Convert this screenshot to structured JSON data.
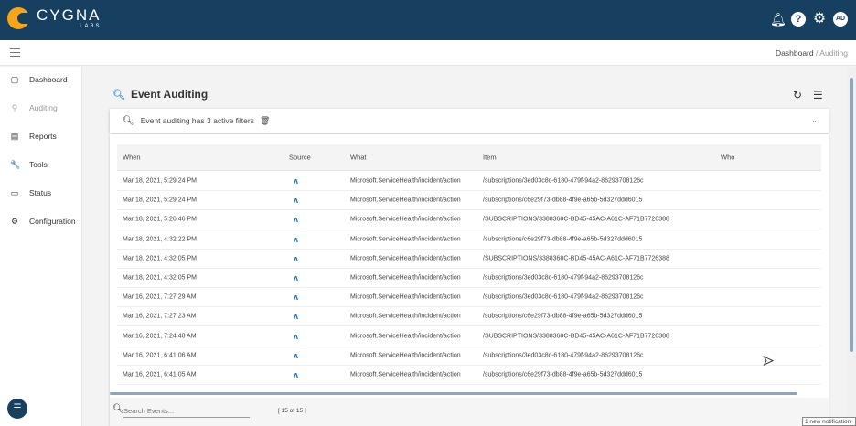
{
  "header": {
    "brand": "CYGNA",
    "brand_sub": "LABS",
    "avatar": "AD",
    "icons": [
      "bell-icon",
      "help-icon",
      "gear-icon"
    ]
  },
  "breadcrumb": {
    "parent": "Dashboard",
    "separator": "/",
    "current": "Auditing"
  },
  "sidebar": {
    "items": [
      {
        "label": "Dashboard",
        "icon": "monitor-icon",
        "glyph": "▢"
      },
      {
        "label": "Auditing",
        "icon": "search-icon",
        "glyph": "⚲",
        "active": true
      },
      {
        "label": "Reports",
        "icon": "reports-icon",
        "glyph": "▤"
      },
      {
        "label": "Tools",
        "icon": "wrench-icon",
        "glyph": "🔧"
      },
      {
        "label": "Status",
        "icon": "status-icon",
        "glyph": "▭"
      },
      {
        "label": "Configuration",
        "icon": "config-icon",
        "glyph": "⚙"
      }
    ]
  },
  "page": {
    "title": "Event Auditing",
    "filter_text": "Event auditing has 3 active filters"
  },
  "table": {
    "columns": [
      "When",
      "Source",
      "What",
      "Item",
      "Who"
    ],
    "rows": [
      [
        "Mar 18, 2021, 5:29:24 PM",
        "Microsoft.ServiceHealth/incident/action",
        "/subscriptions/3ed03c8c-6180-479f-94a2-86293708126c",
        ""
      ],
      [
        "Mar 18, 2021, 5:29:24 PM",
        "Microsoft.ServiceHealth/incident/action",
        "/subscriptions/c6e29f73-db88-4f9e-a65b-5d327ddd6015",
        ""
      ],
      [
        "Mar 18, 2021, 5:26:46 PM",
        "Microsoft.ServiceHealth/incident/action",
        "/SUBSCRIPTIONS/3388368C-BD45-45AC-A61C-AF71B7726388",
        ""
      ],
      [
        "Mar 18, 2021, 4:32:22 PM",
        "Microsoft.ServiceHealth/incident/action",
        "/subscriptions/c6e29f73-db88-4f9e-a65b-5d327ddd6015",
        ""
      ],
      [
        "Mar 18, 2021, 4:32:05 PM",
        "Microsoft.ServiceHealth/incident/action",
        "/SUBSCRIPTIONS/3388368C-BD45-45AC-A61C-AF71B7726388",
        ""
      ],
      [
        "Mar 18, 2021, 4:32:05 PM",
        "Microsoft.ServiceHealth/incident/action",
        "/subscriptions/3ed03c8c-6180-479f-94a2-86293708126c",
        ""
      ],
      [
        "Mar 16, 2021, 7:27:29 AM",
        "Microsoft.ServiceHealth/incident/action",
        "/subscriptions/3ed03c8c-6180-479f-94a2-86293708126c",
        ""
      ],
      [
        "Mar 16, 2021, 7:27:23 AM",
        "Microsoft.ServiceHealth/incident/action",
        "/subscriptions/c6e29f73-db88-4f9e-a65b-5d327ddd6015",
        ""
      ],
      [
        "Mar 16, 2021, 7:24:48 AM",
        "Microsoft.ServiceHealth/incident/action",
        "/SUBSCRIPTIONS/3388368C-BD45-45AC-A61C-AF71B7726388",
        ""
      ],
      [
        "Mar 16, 2021, 6:41:06 AM",
        "Microsoft.ServiceHealth/incident/action",
        "/subscriptions/3ed03c8c-6180-479f-94a2-86293708126c",
        ""
      ],
      [
        "Mar 16, 2021, 6:41:05 AM",
        "Microsoft.ServiceHealth/incident/action",
        "/subscriptions/c6e29f73-db88-4f9e-a65b-5d327ddd6015",
        ""
      ]
    ],
    "source_icon": "azure-icon"
  },
  "footer": {
    "search_placeholder": "Search Events...",
    "count": "[ 15 of 15 ]"
  },
  "notification": "1 new notification",
  "colors": {
    "header": "#173f5f",
    "accent": "#f5a51c",
    "azure": "#1b6bb5"
  }
}
